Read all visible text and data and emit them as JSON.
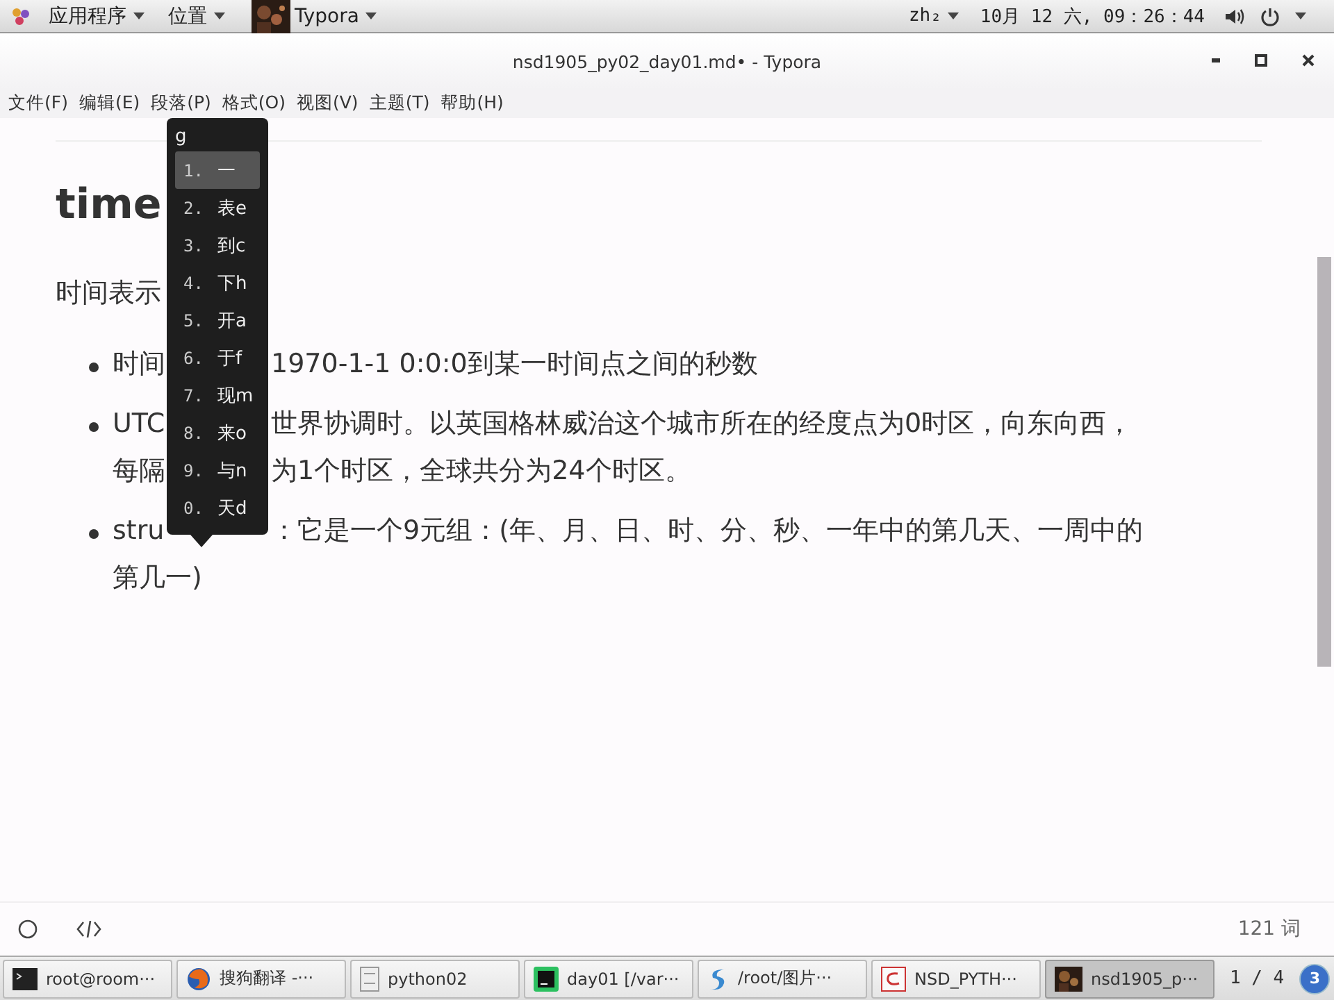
{
  "top_bar": {
    "apps_menu": "应用程序",
    "places_menu": "位置",
    "active_app": "Typora",
    "input_method": "zh₂",
    "clock": "10月 12 六, 09：26：44"
  },
  "window": {
    "title": "nsd1905_py02_day01.md• - Typora"
  },
  "menu": [
    "文件(F)",
    "编辑(E)",
    "段落(P)",
    "格式(O)",
    "视图(V)",
    "主题(T)",
    "帮助(H)"
  ],
  "document": {
    "heading": "time",
    "paragraph": "时间表示",
    "bullets": [
      {
        "lines": [
          {
            "left": "时间",
            "right": "1970-1-1 0:0:0到某一时间点之间的秒数"
          }
        ]
      },
      {
        "lines": [
          {
            "left": "UTC",
            "right": "世界协调时。以英国格林威治这个城市所在的经度点为0时区，向东向西，"
          },
          {
            "left": "每隔",
            "right": "为1个时区，全球共分为24个时区。"
          }
        ]
      },
      {
        "lines": [
          {
            "left": "stru",
            "right": "：它是一个9元组：(年、月、日、时、分、秒、一年中的第几天、一周中的"
          },
          {
            "left": "第几一)"
          }
        ]
      }
    ]
  },
  "ime": {
    "input": "g",
    "candidates": [
      {
        "index": "1.",
        "text": "一",
        "selected": true
      },
      {
        "index": "2.",
        "text": "表e",
        "selected": false
      },
      {
        "index": "3.",
        "text": "到c",
        "selected": false
      },
      {
        "index": "4.",
        "text": "下h",
        "selected": false
      },
      {
        "index": "5.",
        "text": "开a",
        "selected": false
      },
      {
        "index": "6.",
        "text": "于f",
        "selected": false
      },
      {
        "index": "7.",
        "text": "现m",
        "selected": false
      },
      {
        "index": "8.",
        "text": "来o",
        "selected": false
      },
      {
        "index": "9.",
        "text": "与n",
        "selected": false
      },
      {
        "index": "0.",
        "text": "天d",
        "selected": false
      }
    ]
  },
  "status_bar": {
    "word_count": "121 词"
  },
  "taskbar": {
    "items": [
      {
        "label": "root@room···",
        "kind": "terminal",
        "selected": false
      },
      {
        "label": "搜狗翻译 -···",
        "kind": "browser",
        "selected": false
      },
      {
        "label": "python02",
        "kind": "files",
        "selected": false
      },
      {
        "label": "day01 [/var···",
        "kind": "ide",
        "selected": false
      },
      {
        "label": "/root/图片···",
        "kind": "viewer",
        "selected": false
      },
      {
        "label": "NSD_PYTH···",
        "kind": "editor",
        "selected": false
      },
      {
        "label": "nsd1905_p···",
        "kind": "typora",
        "selected": true
      }
    ],
    "workspace": "1 / 4",
    "notifications": "3"
  }
}
